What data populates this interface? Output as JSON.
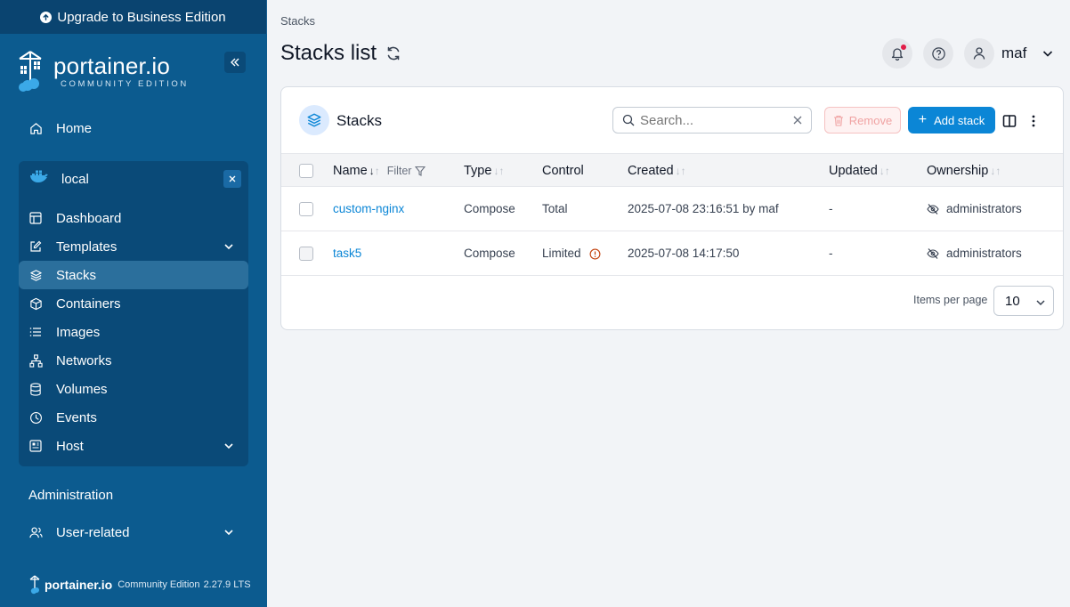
{
  "sidebar": {
    "upgrade_label": "Upgrade to Business Edition",
    "logo_title": "portainer.io",
    "logo_subtitle": "COMMUNITY EDITION",
    "home_label": "Home",
    "environment": {
      "name": "local",
      "items": [
        {
          "label": "Dashboard",
          "icon": "dashboard-icon"
        },
        {
          "label": "Templates",
          "icon": "edit-icon",
          "expandable": true
        },
        {
          "label": "Stacks",
          "icon": "layers-icon",
          "active": true
        },
        {
          "label": "Containers",
          "icon": "box-icon"
        },
        {
          "label": "Images",
          "icon": "list-icon"
        },
        {
          "label": "Networks",
          "icon": "network-icon"
        },
        {
          "label": "Volumes",
          "icon": "database-icon"
        },
        {
          "label": "Events",
          "icon": "clock-icon"
        },
        {
          "label": "Host",
          "icon": "server-icon",
          "expandable": true
        }
      ]
    },
    "administration_label": "Administration",
    "user_related_label": "User-related",
    "footer": {
      "brand": "portainer.io",
      "edition": "Community Edition",
      "version": "2.27.9 LTS"
    }
  },
  "header": {
    "breadcrumb": "Stacks",
    "title": "Stacks list",
    "username": "maf"
  },
  "card": {
    "title": "Stacks",
    "search_placeholder": "Search...",
    "remove_label": "Remove",
    "add_label": "Add stack",
    "columns": {
      "name": "Name",
      "filter": "Filter",
      "type": "Type",
      "control": "Control",
      "created": "Created",
      "updated": "Updated",
      "ownership": "Ownership"
    },
    "rows": [
      {
        "name": "custom-nginx",
        "type": "Compose",
        "control": "Total",
        "created": "2025-07-08 23:16:51 by maf",
        "updated": "-",
        "ownership": "administrators"
      },
      {
        "name": "task5",
        "type": "Compose",
        "control": "Limited",
        "created": "2025-07-08 14:17:50",
        "updated": "-",
        "ownership": "administrators"
      }
    ],
    "items_per_page_label": "Items per page",
    "items_per_page_value": "10"
  },
  "colors": {
    "sidebar_bg": "#0c5b8f",
    "accent": "#0b86d6",
    "warning": "#c2410c"
  }
}
